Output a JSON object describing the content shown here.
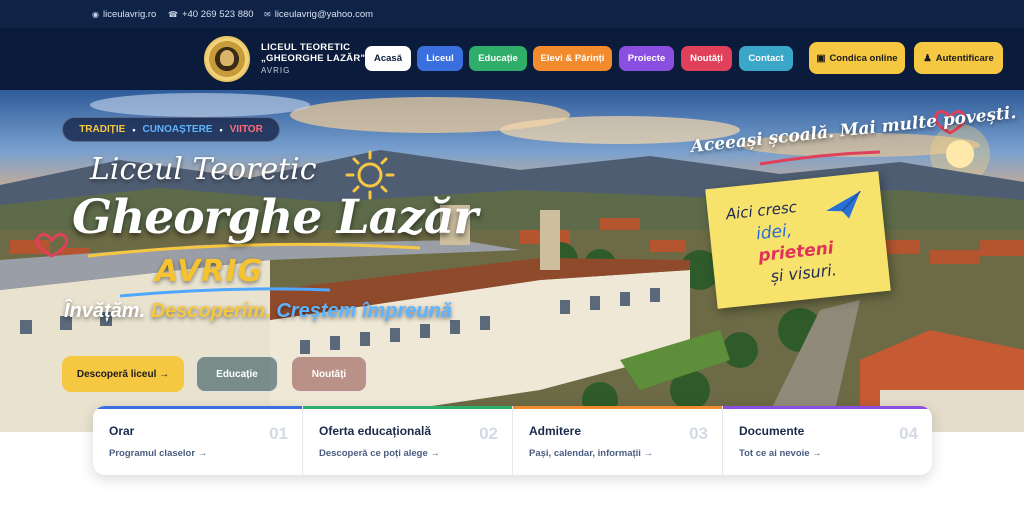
{
  "topbar": {
    "website": "liceulavrig.ro",
    "phone": "+40 269 523 880",
    "email": "liceulavrig@yahoo.com"
  },
  "header": {
    "brand_line1": "LICEUL TEORETIC",
    "brand_line2": "„GHEORGHE LAZĂR\"",
    "brand_line3": "AVRIG",
    "nav": [
      {
        "label": "Acasă",
        "color": "#ffffff",
        "text_color": "#0b1b3b"
      },
      {
        "label": "Liceul",
        "color": "#3a6fe0"
      },
      {
        "label": "Educație",
        "color": "#2fae6a"
      },
      {
        "label": "Elevi & Părinți",
        "color": "#f28a2e"
      },
      {
        "label": "Proiecte",
        "color": "#8a4fe0"
      },
      {
        "label": "Noutăți",
        "color": "#e0405a"
      },
      {
        "label": "Contact",
        "color": "#3aa6c8"
      }
    ],
    "cta_catalog": {
      "icon": "▣",
      "label": "Condica online"
    },
    "cta_login": {
      "icon": "♟",
      "label": "Autentificare"
    }
  },
  "hero": {
    "tagline": {
      "t1": "TRADIȚIE",
      "t2": "CUNOAȘTERE",
      "t3": "VIITOR",
      "sep": "•"
    },
    "title_small": "Liceul Teoretic",
    "title_big": "Gheorghe Lazăr",
    "city": "AVRIG",
    "motto": {
      "w1": "Învățăm.",
      "w2": "Descoperim.",
      "w3": "Creștem împreună"
    },
    "slogan": "Aceeași școală. Mai multe povești.",
    "note": {
      "l1": "Aici cresc",
      "l2": "idei,",
      "l3": "prieteni",
      "l4": "și visuri."
    },
    "buttons": {
      "primary": "Descoperă liceul →",
      "education": "Educație",
      "news": "Noutăți"
    }
  },
  "cards": [
    {
      "title": "Orar",
      "subtitle": "Programul claselor →",
      "number": "01",
      "color": "#3a6fe0"
    },
    {
      "title": "Oferta educațională",
      "subtitle": "Descoperă ce poți alege →",
      "number": "02",
      "color": "#2fae6a"
    },
    {
      "title": "Admitere",
      "subtitle": "Pași, calendar, informații →",
      "number": "03",
      "color": "#f28a2e"
    },
    {
      "title": "Documente",
      "subtitle": "Tot ce ai nevoie →",
      "number": "04",
      "color": "#8a4fe0"
    }
  ],
  "colors": {
    "navy": "#0b1b3b",
    "topbar": "#0f2347",
    "gold": "#f6c740",
    "blue_script": "#4fa8ff"
  },
  "icons": {
    "website": "globe-icon",
    "phone": "phone-icon",
    "email": "mail-icon"
  }
}
